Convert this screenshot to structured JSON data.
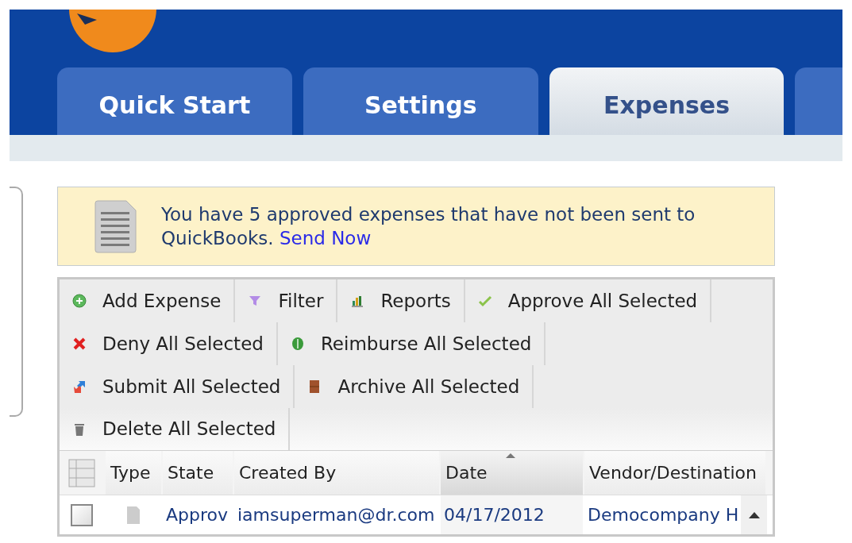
{
  "tabs": [
    {
      "label": "Quick Start",
      "selected": false
    },
    {
      "label": "Settings",
      "selected": false
    },
    {
      "label": "Expenses",
      "selected": true
    }
  ],
  "notice": {
    "text": "You have 5 approved expenses that have not been sent to QuickBooks.",
    "link": "Send Now"
  },
  "toolbar": [
    [
      {
        "label": "Add Expense",
        "kind": "add"
      },
      {
        "label": "Filter",
        "kind": "filter"
      },
      {
        "label": "Reports",
        "kind": "reports"
      },
      {
        "label": "Approve All Selected",
        "kind": "approve"
      }
    ],
    [
      {
        "label": "Deny All Selected",
        "kind": "deny"
      },
      {
        "label": "Reimburse All Selected",
        "kind": "reimburse"
      }
    ],
    [
      {
        "label": "Submit All Selected",
        "kind": "submit"
      },
      {
        "label": "Archive All Selected",
        "kind": "archive"
      }
    ],
    [
      {
        "label": "Delete All Selected",
        "kind": "delete"
      }
    ]
  ],
  "table": {
    "columns": [
      {
        "label": "Type",
        "sorted": false
      },
      {
        "label": "State",
        "sorted": false
      },
      {
        "label": "Created By",
        "sorted": false
      },
      {
        "label": "Date",
        "sorted": true
      },
      {
        "label": "Vendor/Destination",
        "sorted": false
      }
    ],
    "rows": [
      {
        "checked": false,
        "cells": [
          "",
          "Approv",
          "iamsuperman@dr.com",
          "04/17/2012",
          "Democompany H"
        ]
      }
    ]
  }
}
